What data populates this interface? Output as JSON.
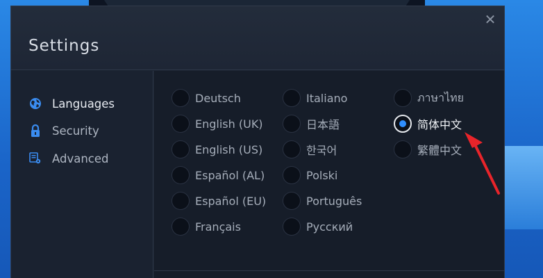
{
  "window": {
    "title": "Settings",
    "close_glyph": "✕"
  },
  "sidebar": {
    "items": [
      {
        "label": "Languages",
        "icon": "globe-icon",
        "active": true
      },
      {
        "label": "Security",
        "icon": "lock-icon",
        "active": false
      },
      {
        "label": "Advanced",
        "icon": "advanced-settings-icon",
        "active": false
      }
    ]
  },
  "languages": {
    "columns": [
      [
        "Deutsch",
        "English (UK)",
        "English (US)",
        "Español (AL)",
        "Español (EU)",
        "Français"
      ],
      [
        "Italiano",
        "日本語",
        "한국어",
        "Polski",
        "Português",
        "Русский"
      ],
      [
        "ภาษาไทย",
        "简体中文",
        "繁體中文"
      ]
    ],
    "selected": "简体中文"
  },
  "colors": {
    "accent": "#2f8fff",
    "annotation_arrow": "#e8242a",
    "dialog_bg": "#1a2230",
    "desktop_bg": "#1f6fd0"
  }
}
